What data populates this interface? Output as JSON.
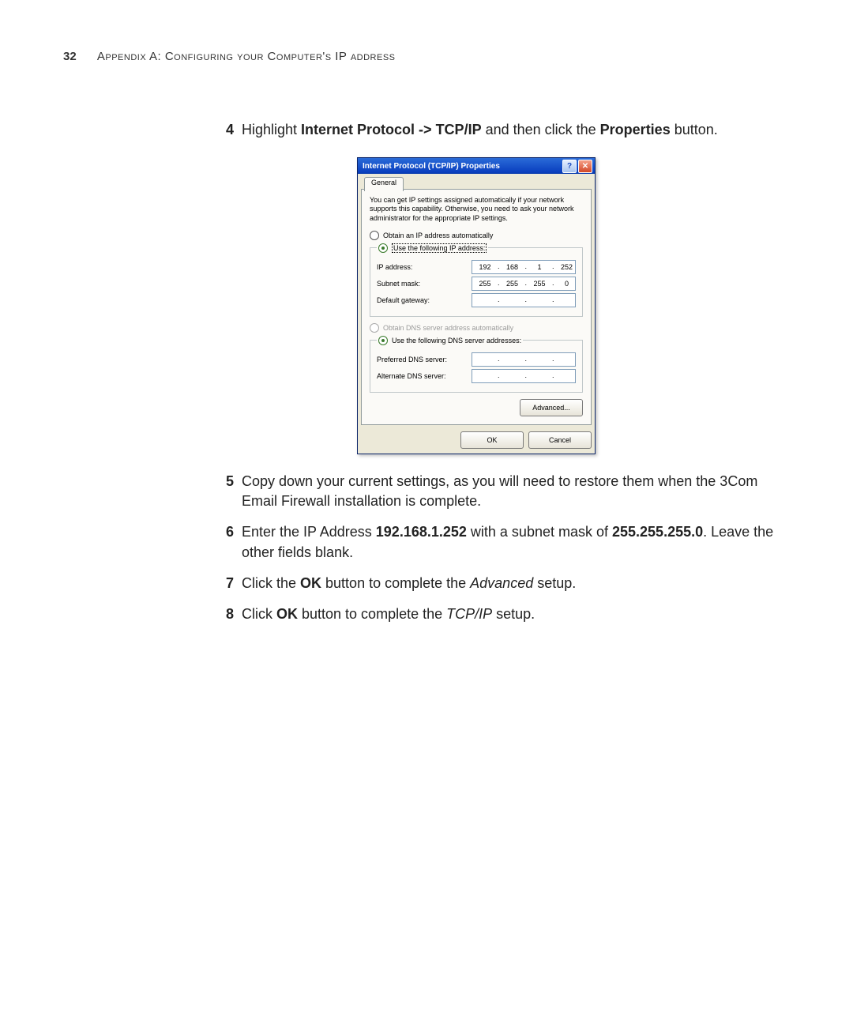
{
  "header": {
    "page_number": "32",
    "running_head": "Appendix A: Configuring your Computer's IP address"
  },
  "steps": {
    "s4": {
      "num": "4",
      "pre": "Highlight ",
      "b1": "Internet Protocol -> TCP/IP",
      "mid": " and then click the ",
      "b2": "Properties",
      "post": " button."
    },
    "s5": {
      "num": "5",
      "text": "Copy down your current settings, as you will need to restore them when the 3Com Email Firewall installation is complete."
    },
    "s6": {
      "num": "6",
      "pre": "Enter the IP Address ",
      "b1": "192.168.1.252",
      "mid": " with a subnet mask of ",
      "b2": "255.255.255.0",
      "post": ". Leave the other fields blank."
    },
    "s7": {
      "num": "7",
      "pre": "Click the ",
      "b1": "OK",
      "mid": " button to complete the ",
      "i1": "Advanced",
      "post": " setup."
    },
    "s8": {
      "num": "8",
      "pre": "Click ",
      "b1": "OK",
      "mid": " button to complete the ",
      "i1": "TCP/IP",
      "post": " setup."
    }
  },
  "dialog": {
    "title": "Internet Protocol (TCP/IP) Properties",
    "help_btn": "?",
    "close_btn": "✕",
    "tab": "General",
    "explain": "You can get IP settings assigned automatically if your network supports this capability. Otherwise, you need to ask your network administrator for the appropriate IP settings.",
    "radio_auto_ip": "Obtain an IP address automatically",
    "radio_manual_ip": "Use the following IP address:",
    "lbl_ip": "IP address:",
    "lbl_mask": "Subnet mask:",
    "lbl_gw": "Default gateway:",
    "ip": {
      "o1": "192",
      "o2": "168",
      "o3": "1",
      "o4": "252"
    },
    "mask": {
      "o1": "255",
      "o2": "255",
      "o3": "255",
      "o4": "0"
    },
    "gw": {
      "o1": "",
      "o2": "",
      "o3": "",
      "o4": ""
    },
    "radio_auto_dns": "Obtain DNS server address automatically",
    "radio_manual_dns": "Use the following DNS server addresses:",
    "lbl_dns1": "Preferred DNS server:",
    "lbl_dns2": "Alternate DNS server:",
    "dns1": {
      "o1": "",
      "o2": "",
      "o3": "",
      "o4": ""
    },
    "dns2": {
      "o1": "",
      "o2": "",
      "o3": "",
      "o4": ""
    },
    "advanced_btn": "Advanced...",
    "ok_btn": "OK",
    "cancel_btn": "Cancel"
  }
}
